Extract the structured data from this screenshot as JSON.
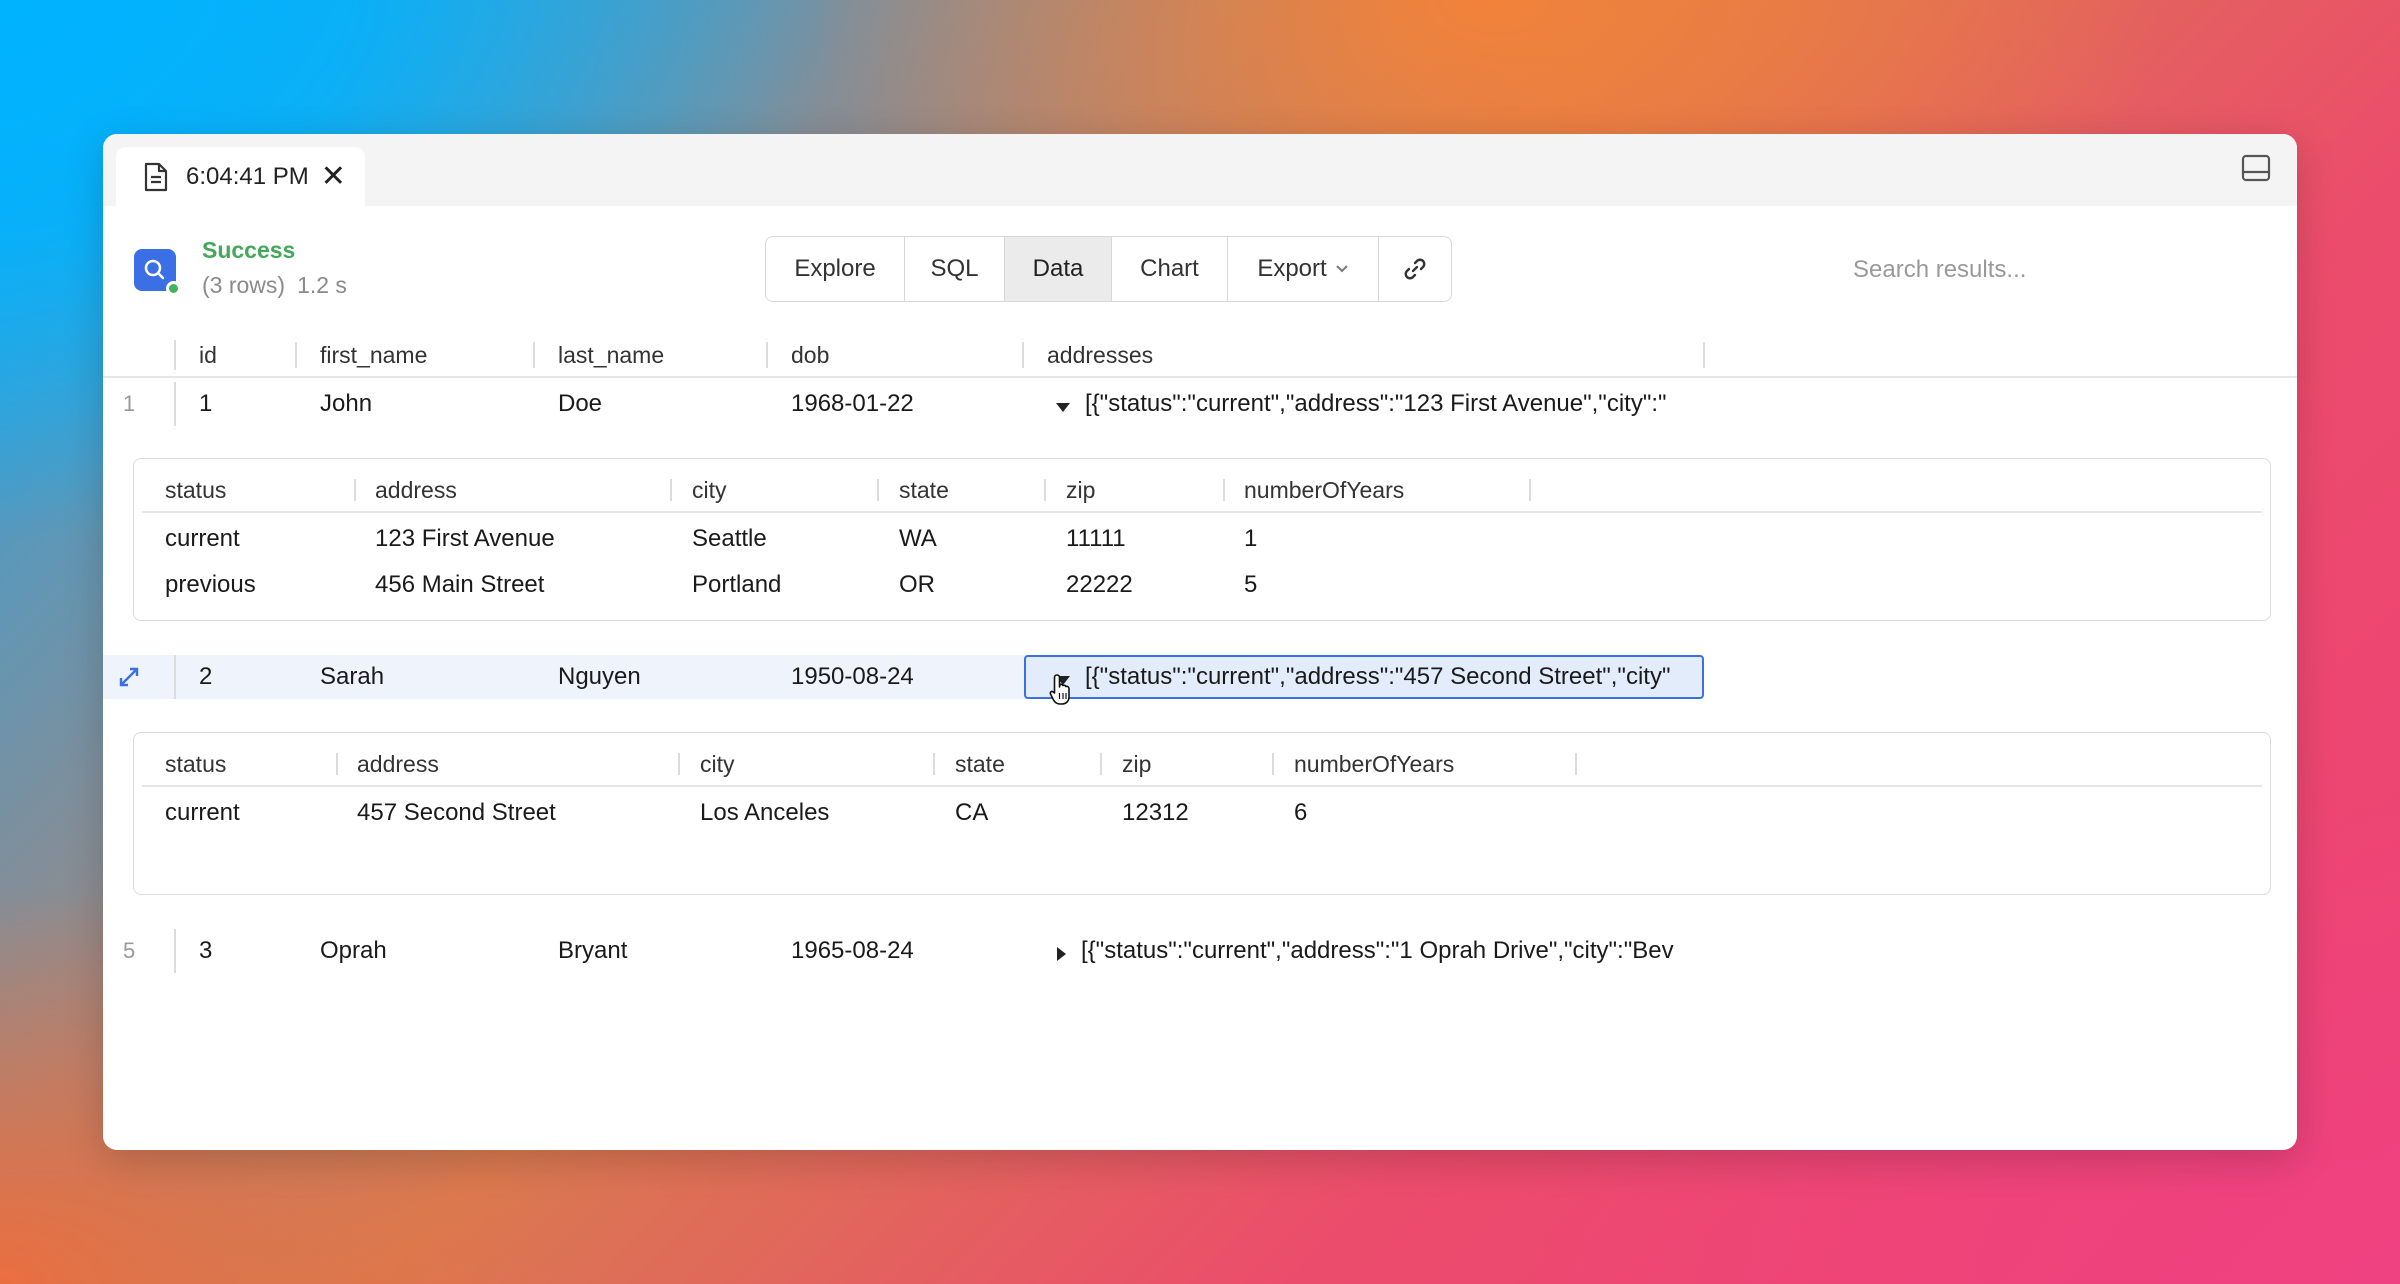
{
  "tab": {
    "title": "6:04:41 PM",
    "close": "✕",
    "icon": "document-icon"
  },
  "status": {
    "title": "Success",
    "rows": "(3 rows)",
    "time": "1.2 s"
  },
  "toolbar": {
    "explore": "Explore",
    "sql": "SQL",
    "data": "Data",
    "chart": "Chart",
    "export": "Export",
    "link_icon": "link-icon",
    "active": "Data"
  },
  "search": {
    "placeholder": "Search results..."
  },
  "columns": [
    "id",
    "first_name",
    "last_name",
    "dob",
    "addresses"
  ],
  "nested_columns": [
    "status",
    "address",
    "city",
    "state",
    "zip",
    "numberOfYears"
  ],
  "rows": [
    {
      "num": "1",
      "id": "1",
      "first_name": "John",
      "last_name": "Doe",
      "dob": "1968-01-22",
      "addresses": "[{\"status\":\"current\",\"address\":\"123 First Avenue\",\"city\":\"",
      "expanded": true,
      "nested": [
        [
          "current",
          "123 First Avenue",
          "Seattle",
          "WA",
          "11111",
          "1"
        ],
        [
          "previous",
          "456 Main Street",
          "Portland",
          "OR",
          "22222",
          "5"
        ]
      ]
    },
    {
      "num": "",
      "id": "2",
      "first_name": "Sarah",
      "last_name": "Nguyen",
      "dob": "1950-08-24",
      "addresses": "[{\"status\":\"current\",\"address\":\"457 Second Street\",\"city\"",
      "expanded": true,
      "nested": [
        [
          "current",
          "457 Second Street",
          "Los Anceles",
          "CA",
          "12312",
          "6"
        ]
      ]
    },
    {
      "num": "5",
      "id": "3",
      "first_name": "Oprah",
      "last_name": "Bryant",
      "dob": "1965-08-24",
      "addresses": "[{\"status\":\"current\",\"address\":\"1 Oprah Drive\",\"city\":\"Bev",
      "expanded": false
    }
  ],
  "colors": {
    "accent": "#3b6fe6",
    "success": "#42a85a",
    "selected_bg": "#eef3fc"
  }
}
